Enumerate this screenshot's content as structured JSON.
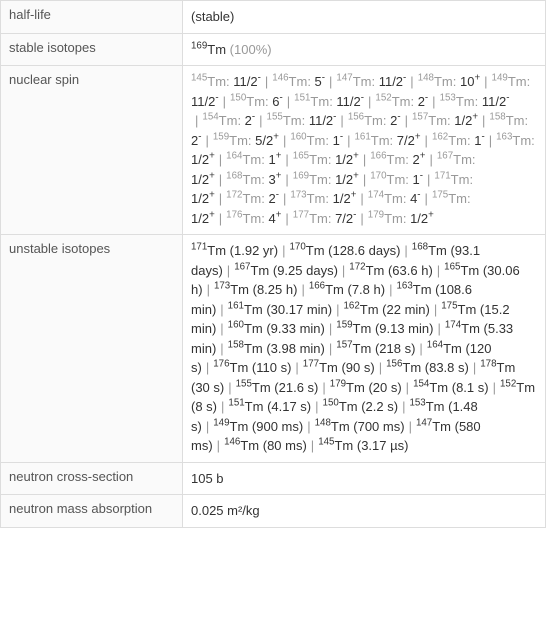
{
  "rows": {
    "half_life": {
      "label": "half-life",
      "value": "(stable)"
    },
    "stable_isotopes": {
      "label": "stable isotopes",
      "items": [
        {
          "mass": "169",
          "sym": "Tm",
          "detail": "(100%)"
        }
      ]
    },
    "nuclear_spin": {
      "label": "nuclear spin",
      "items": [
        {
          "mass": "145",
          "sym": "Tm",
          "spin": "11/2",
          "sign": "-"
        },
        {
          "mass": "146",
          "sym": "Tm",
          "spin": "5",
          "sign": "-"
        },
        {
          "mass": "147",
          "sym": "Tm",
          "spin": "11/2",
          "sign": "-"
        },
        {
          "mass": "148",
          "sym": "Tm",
          "spin": "10",
          "sign": "+"
        },
        {
          "mass": "149",
          "sym": "Tm",
          "spin": "11/2",
          "sign": "-"
        },
        {
          "mass": "150",
          "sym": "Tm",
          "spin": "6",
          "sign": "-"
        },
        {
          "mass": "151",
          "sym": "Tm",
          "spin": "11/2",
          "sign": "-"
        },
        {
          "mass": "152",
          "sym": "Tm",
          "spin": "2",
          "sign": "-"
        },
        {
          "mass": "153",
          "sym": "Tm",
          "spin": "11/2",
          "sign": "-"
        },
        {
          "mass": "154",
          "sym": "Tm",
          "spin": "2",
          "sign": "-"
        },
        {
          "mass": "155",
          "sym": "Tm",
          "spin": "11/2",
          "sign": "-"
        },
        {
          "mass": "156",
          "sym": "Tm",
          "spin": "2",
          "sign": "-"
        },
        {
          "mass": "157",
          "sym": "Tm",
          "spin": "1/2",
          "sign": "+"
        },
        {
          "mass": "158",
          "sym": "Tm",
          "spin": "2",
          "sign": "-"
        },
        {
          "mass": "159",
          "sym": "Tm",
          "spin": "5/2",
          "sign": "+"
        },
        {
          "mass": "160",
          "sym": "Tm",
          "spin": "1",
          "sign": "-"
        },
        {
          "mass": "161",
          "sym": "Tm",
          "spin": "7/2",
          "sign": "+"
        },
        {
          "mass": "162",
          "sym": "Tm",
          "spin": "1",
          "sign": "-"
        },
        {
          "mass": "163",
          "sym": "Tm",
          "spin": "1/2",
          "sign": "+"
        },
        {
          "mass": "164",
          "sym": "Tm",
          "spin": "1",
          "sign": "+"
        },
        {
          "mass": "165",
          "sym": "Tm",
          "spin": "1/2",
          "sign": "+"
        },
        {
          "mass": "166",
          "sym": "Tm",
          "spin": "2",
          "sign": "+"
        },
        {
          "mass": "167",
          "sym": "Tm",
          "spin": "1/2",
          "sign": "+"
        },
        {
          "mass": "168",
          "sym": "Tm",
          "spin": "3",
          "sign": "+"
        },
        {
          "mass": "169",
          "sym": "Tm",
          "spin": "1/2",
          "sign": "+"
        },
        {
          "mass": "170",
          "sym": "Tm",
          "spin": "1",
          "sign": "-"
        },
        {
          "mass": "171",
          "sym": "Tm",
          "spin": "1/2",
          "sign": "+"
        },
        {
          "mass": "172",
          "sym": "Tm",
          "spin": "2",
          "sign": "-"
        },
        {
          "mass": "173",
          "sym": "Tm",
          "spin": "1/2",
          "sign": "+"
        },
        {
          "mass": "174",
          "sym": "Tm",
          "spin": "4",
          "sign": "-"
        },
        {
          "mass": "175",
          "sym": "Tm",
          "spin": "1/2",
          "sign": "+"
        },
        {
          "mass": "176",
          "sym": "Tm",
          "spin": "4",
          "sign": "+"
        },
        {
          "mass": "177",
          "sym": "Tm",
          "spin": "7/2",
          "sign": "-"
        },
        {
          "mass": "179",
          "sym": "Tm",
          "spin": "1/2",
          "sign": "+"
        }
      ]
    },
    "unstable_isotopes": {
      "label": "unstable isotopes",
      "items": [
        {
          "mass": "171",
          "sym": "Tm",
          "detail": "(1.92 yr)"
        },
        {
          "mass": "170",
          "sym": "Tm",
          "detail": "(128.6 days)"
        },
        {
          "mass": "168",
          "sym": "Tm",
          "detail": "(93.1 days)"
        },
        {
          "mass": "167",
          "sym": "Tm",
          "detail": "(9.25 days)"
        },
        {
          "mass": "172",
          "sym": "Tm",
          "detail": "(63.6 h)"
        },
        {
          "mass": "165",
          "sym": "Tm",
          "detail": "(30.06 h)"
        },
        {
          "mass": "173",
          "sym": "Tm",
          "detail": "(8.25 h)"
        },
        {
          "mass": "166",
          "sym": "Tm",
          "detail": "(7.8 h)"
        },
        {
          "mass": "163",
          "sym": "Tm",
          "detail": "(108.6 min)"
        },
        {
          "mass": "161",
          "sym": "Tm",
          "detail": "(30.17 min)"
        },
        {
          "mass": "162",
          "sym": "Tm",
          "detail": "(22 min)"
        },
        {
          "mass": "175",
          "sym": "Tm",
          "detail": "(15.2 min)"
        },
        {
          "mass": "160",
          "sym": "Tm",
          "detail": "(9.33 min)"
        },
        {
          "mass": "159",
          "sym": "Tm",
          "detail": "(9.13 min)"
        },
        {
          "mass": "174",
          "sym": "Tm",
          "detail": "(5.33 min)"
        },
        {
          "mass": "158",
          "sym": "Tm",
          "detail": "(3.98 min)"
        },
        {
          "mass": "157",
          "sym": "Tm",
          "detail": "(218 s)"
        },
        {
          "mass": "164",
          "sym": "Tm",
          "detail": "(120 s)"
        },
        {
          "mass": "176",
          "sym": "Tm",
          "detail": "(110 s)"
        },
        {
          "mass": "177",
          "sym": "Tm",
          "detail": "(90 s)"
        },
        {
          "mass": "156",
          "sym": "Tm",
          "detail": "(83.8 s)"
        },
        {
          "mass": "178",
          "sym": "Tm",
          "detail": "(30 s)"
        },
        {
          "mass": "155",
          "sym": "Tm",
          "detail": "(21.6 s)"
        },
        {
          "mass": "179",
          "sym": "Tm",
          "detail": "(20 s)"
        },
        {
          "mass": "154",
          "sym": "Tm",
          "detail": "(8.1 s)"
        },
        {
          "mass": "152",
          "sym": "Tm",
          "detail": "(8 s)"
        },
        {
          "mass": "151",
          "sym": "Tm",
          "detail": "(4.17 s)"
        },
        {
          "mass": "150",
          "sym": "Tm",
          "detail": "(2.2 s)"
        },
        {
          "mass": "153",
          "sym": "Tm",
          "detail": "(1.48 s)"
        },
        {
          "mass": "149",
          "sym": "Tm",
          "detail": "(900 ms)"
        },
        {
          "mass": "148",
          "sym": "Tm",
          "detail": "(700 ms)"
        },
        {
          "mass": "147",
          "sym": "Tm",
          "detail": "(580 ms)"
        },
        {
          "mass": "146",
          "sym": "Tm",
          "detail": "(80 ms)"
        },
        {
          "mass": "145",
          "sym": "Tm",
          "detail": "(3.17 µs)"
        }
      ]
    },
    "neutron_cross_section": {
      "label": "neutron cross-section",
      "value": "105 b"
    },
    "neutron_mass_absorption": {
      "label": "neutron mass absorption",
      "value": "0.025 m²/kg"
    }
  },
  "unstable_value_class": "gray"
}
